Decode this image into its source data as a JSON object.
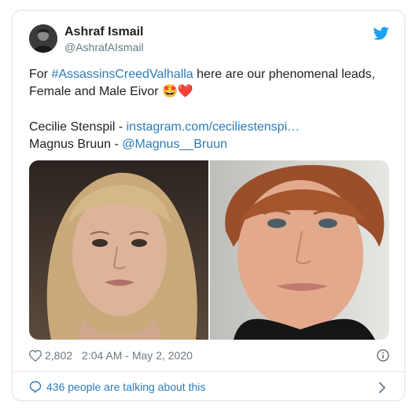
{
  "tweet": {
    "author_name": "Ashraf Ismail",
    "author_handle": "@AshrafAIsmail",
    "body_prefix": "For ",
    "hashtag": "#AssassinsCreedValhalla",
    "body_suffix": " here are our phenomenal leads,",
    "line2_text": "Female and Male Eivor ",
    "line2_emoji": "🤩❤️",
    "credit1_name": "Cecilie Stenspil - ",
    "credit1_link": "instagram.com/ceciliestenspi…",
    "credit2_name": "Magnus Bruun - ",
    "credit2_link": "@Magnus__Bruun"
  },
  "stats": {
    "likes": "2,802",
    "timestamp": "2:04 AM - May 2, 2020"
  },
  "footer": {
    "conversation_text": "436 people are talking about this"
  },
  "colors": {
    "link": "#2b7bb9",
    "meta_gray": "#697882",
    "border": "#e1e8ed",
    "twitter_blue": "#1da1f2"
  },
  "icons": {
    "brand": "twitter-bird-icon",
    "like": "heart-icon",
    "info": "info-icon",
    "reply": "speech-bubble-icon",
    "more": "chevron-right-icon"
  }
}
